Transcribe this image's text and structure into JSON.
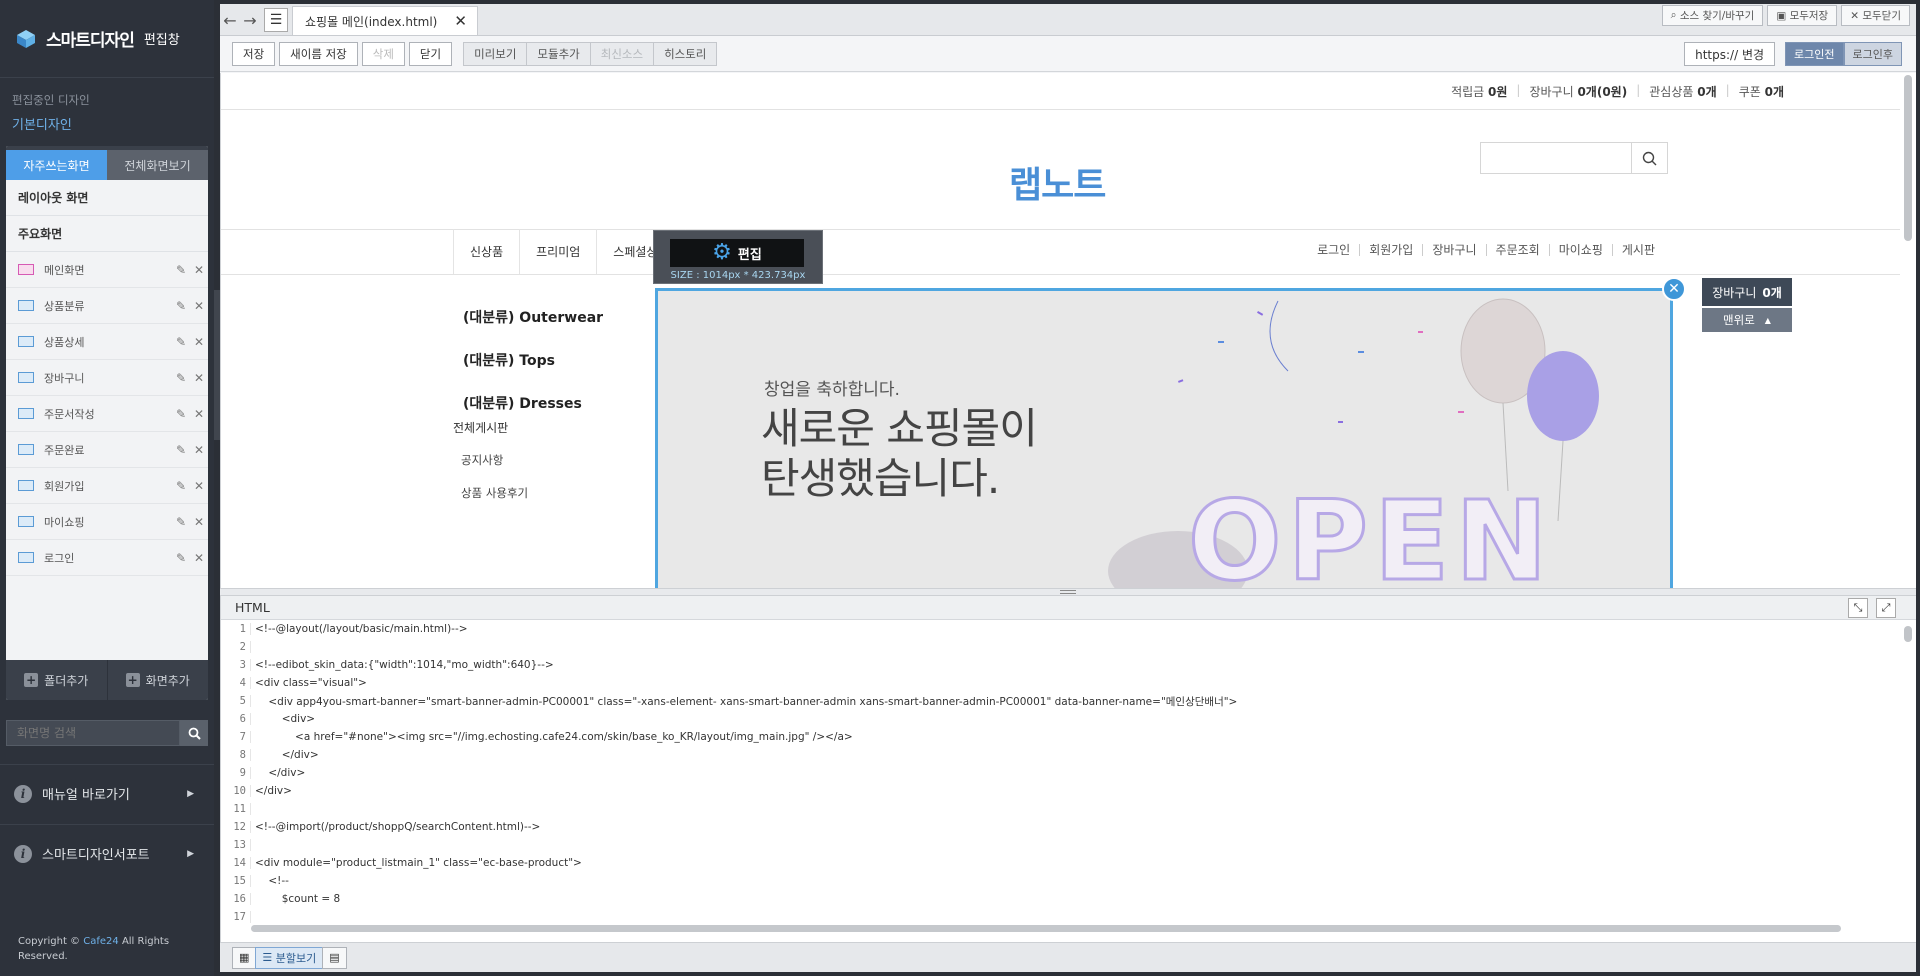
{
  "sidebar": {
    "title": "스마트디자인",
    "subtitle": "편집창",
    "current_label": "편집중인 디자인",
    "current_design": "기본디자인",
    "tabs": [
      "자주쓰는화면",
      "전체화면보기"
    ],
    "sections": [
      "레이아웃 화면",
      "주요화면"
    ],
    "items": [
      "메인화면",
      "상품분류",
      "상품상세",
      "장바구니",
      "주문서작성",
      "주문완료",
      "회원가입",
      "마이쇼핑",
      "로그인"
    ],
    "footer": [
      "폴더추가",
      "화면추가"
    ],
    "search_placeholder": "화면명 검색",
    "links": [
      "매뉴얼 바로가기",
      "스마트디자인서포트"
    ],
    "copyright": {
      "prefix": "Copyright ©",
      "brand": "Cafe24",
      "suffix": "All Rights Reserved."
    }
  },
  "tabbar": {
    "tab_label": "쇼핑몰 메인(index.html)",
    "tools": [
      "소스 찾기/바꾸기",
      "모두저장",
      "모두닫기"
    ]
  },
  "toolbar": {
    "buttons": [
      "저장",
      "새이름 저장",
      "삭제",
      "닫기"
    ],
    "group": [
      "미리보기",
      "모듈추가",
      "최신소스",
      "히스토리"
    ],
    "https": "https:// 변경",
    "login": [
      "로그인전",
      "로그인후"
    ]
  },
  "preview": {
    "topinfo": {
      "points_label": "적립금",
      "points": "0원",
      "cart_label": "장바구니",
      "cart": "0개(0원)",
      "wish_label": "관심상품",
      "wish": "0개",
      "coupon_label": "쿠폰",
      "coupon": "0개"
    },
    "brand": "랩노트",
    "menu": [
      "신상품",
      "프리미엄",
      "스페셜상품"
    ],
    "usermenu": [
      "로그인",
      "회원가입",
      "장바구니",
      "주문조회",
      "마이쇼핑",
      "게시판"
    ],
    "edit": {
      "label": "편집",
      "size": "SIZE : 1014px * 423.734px"
    },
    "categories": [
      "(대분류) Outerwear",
      "(대분류) Tops",
      "(대분류) Dresses"
    ],
    "boards": {
      "title": "전체게시판",
      "items": [
        "공지사항",
        "상품 사용후기"
      ]
    },
    "banner": {
      "line1": "창업을 축하합니다.",
      "line2": "새로운 쇼핑몰이",
      "line3": "탄생했습니다.",
      "balloon": "OPEN"
    },
    "cart_float": {
      "label": "장바구니",
      "count": "0개",
      "top": "맨위로"
    }
  },
  "code": {
    "title": "HTML",
    "lines": [
      "<!--@layout(/layout/basic/main.html)-->",
      "",
      "<!--edibot_skin_data:{\"width\":1014,\"mo_width\":640}-->",
      "<div class=\"visual\">",
      "    <div app4you-smart-banner=\"smart-banner-admin-PC00001\" class=\"-xans-element- xans-smart-banner-admin xans-smart-banner-admin-PC00001\" data-banner-name=\"메인상단배너\">",
      "        <div>",
      "            <a href=\"#none\"><img src=\"//img.echosting.cafe24.com/skin/base_ko_KR/layout/img_main.jpg\" /></a>",
      "        </div>",
      "    </div>",
      "</div>",
      "",
      "<!--@import(/product/shoppQ/searchContent.html)-->",
      "",
      "<div module=\"product_listmain_1\" class=\"ec-base-product\">",
      "    <!--",
      "        $count = 8",
      ""
    ]
  },
  "bottombar": {
    "split_label": "분할보기"
  },
  "colors": {
    "accent": "#4e9ee8",
    "brand": "#4a8fd6",
    "sidebar_bg": "#2d323b",
    "banner_border": "#4fa6e0"
  }
}
